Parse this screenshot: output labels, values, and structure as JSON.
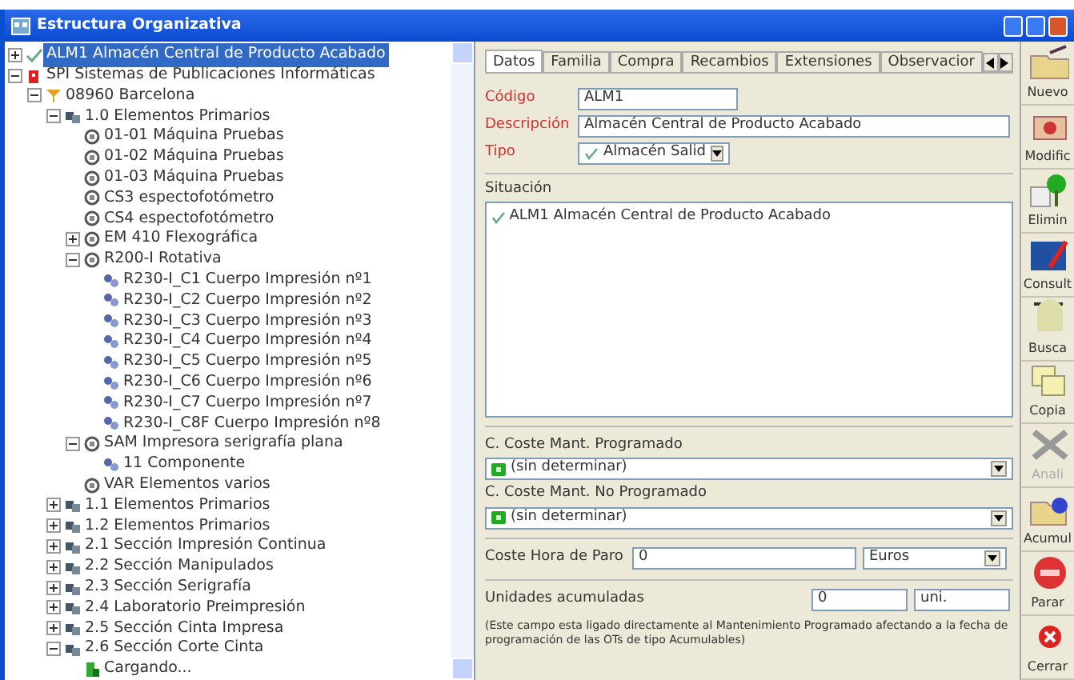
{
  "window": {
    "title": "Estructura Organizativa"
  },
  "tree": [
    {
      "label": "ALM1 Almacén Central de Producto Acabado",
      "kind": "check",
      "expanded": false,
      "selected": true
    },
    {
      "label": "SPI Sistemas de Publicaciones Informáticas",
      "kind": "company",
      "expanded": true,
      "selected": false,
      "children": [
        {
          "label": "08960 Barcelona",
          "kind": "site",
          "expanded": true,
          "selected": false,
          "children": [
            {
              "label": "1.0 Elementos Primarios",
              "kind": "group",
              "expanded": true,
              "selected": false,
              "children": [
                {
                  "label": "01-01 Máquina Pruebas",
                  "kind": "machine",
                  "selected": false
                },
                {
                  "label": "01-02 Máquina Pruebas",
                  "kind": "machine",
                  "selected": false
                },
                {
                  "label": "01-03 Máquina Pruebas",
                  "kind": "machine",
                  "selected": false
                },
                {
                  "label": "CS3 espectofotómetro",
                  "kind": "machine",
                  "selected": false
                },
                {
                  "label": "CS4 espectofotómetro",
                  "kind": "machine",
                  "selected": false
                },
                {
                  "label": "EM 410 Flexográfica",
                  "kind": "machine",
                  "expanded": false,
                  "selected": false
                },
                {
                  "label": "R200-I Rotativa",
                  "kind": "machine",
                  "expanded": true,
                  "selected": false,
                  "children": [
                    {
                      "label": "R230-I_C1 Cuerpo Impresión nº1",
                      "kind": "component",
                      "selected": false
                    },
                    {
                      "label": "R230-I_C2 Cuerpo Impresión nº2",
                      "kind": "component",
                      "selected": false
                    },
                    {
                      "label": "R230-I_C3 Cuerpo Impresión nº3",
                      "kind": "component",
                      "selected": false
                    },
                    {
                      "label": "R230-I_C4 Cuerpo Impresión nº4",
                      "kind": "component",
                      "selected": false
                    },
                    {
                      "label": "R230-I_C5 Cuerpo Impresión nº5",
                      "kind": "component",
                      "selected": false
                    },
                    {
                      "label": "R230-I_C6 Cuerpo Impresión nº6",
                      "kind": "component",
                      "selected": false
                    },
                    {
                      "label": "R230-I_C7 Cuerpo Impresión nº7",
                      "kind": "component",
                      "selected": false
                    },
                    {
                      "label": "R230-I_C8F Cuerpo Impresión nº8",
                      "kind": "component",
                      "selected": false
                    }
                  ]
                },
                {
                  "label": "SAM Impresora serigrafía plana",
                  "kind": "machine",
                  "expanded": true,
                  "selected": false,
                  "children": [
                    {
                      "label": "11 Componente",
                      "kind": "component",
                      "selected": false
                    }
                  ]
                },
                {
                  "label": "VAR Elementos varios",
                  "kind": "machine",
                  "selected": false
                }
              ]
            },
            {
              "label": "1.1 Elementos Primarios",
              "kind": "group",
              "expanded": false,
              "selected": false
            },
            {
              "label": "1.2 Elementos Primarios",
              "kind": "group",
              "expanded": false,
              "selected": false
            },
            {
              "label": "2.1 Sección Impresión Continua",
              "kind": "group",
              "expanded": false,
              "selected": false
            },
            {
              "label": "2.2 Sección Manipulados",
              "kind": "group",
              "expanded": false,
              "selected": false
            },
            {
              "label": "2.3 Sección Serigrafía",
              "kind": "group",
              "expanded": false,
              "selected": false
            },
            {
              "label": "2.4 Laboratorio Preimpresión",
              "kind": "group",
              "expanded": false,
              "selected": false
            },
            {
              "label": "2.5 Sección Cinta Impresa",
              "kind": "group",
              "expanded": false,
              "selected": false
            },
            {
              "label": "2.6 Sección Corte Cinta",
              "kind": "group",
              "expanded": true,
              "selected": false,
              "children": [
                {
                  "label": "Cargando...",
                  "kind": "loading",
                  "selected": false
                }
              ]
            }
          ]
        }
      ]
    }
  ],
  "tabs": [
    {
      "label": "Datos",
      "selected": true
    },
    {
      "label": "Familia",
      "selected": false
    },
    {
      "label": "Compra",
      "selected": false
    },
    {
      "label": "Recambios",
      "selected": false
    },
    {
      "label": "Extensiones",
      "selected": false
    },
    {
      "label": "Observacior",
      "selected": false
    }
  ],
  "form": {
    "codigo": {
      "label": "Código",
      "value": "ALM1"
    },
    "descripcion": {
      "label": "Descripción",
      "value": "Almacén Central de Producto Acabado"
    },
    "tipo": {
      "label": "Tipo",
      "value": "Almacén Salid"
    },
    "situacion": {
      "label": "Situación",
      "items": [
        "ALM1 Almacén Central de Producto Acabado"
      ]
    },
    "coste_programado": {
      "label": "C. Coste Mant. Programado",
      "value": "(sin determinar)"
    },
    "coste_no_programado": {
      "label": "C. Coste Mant. No Programado",
      "value": "(sin determinar)"
    },
    "coste_hora": {
      "label": "Coste Hora de Paro",
      "value": "0",
      "currency": "Euros"
    },
    "unidades": {
      "label": "Unidades acumuladas",
      "value": "0",
      "unit": "uni."
    },
    "note": "(Este campo esta ligado directamente al Mantenimiento Programado afectando a la fecha de programación de las OTs de tipo Acumulables)"
  },
  "toolbar": [
    {
      "label": "Nuevo",
      "kind": "new",
      "disabled": false
    },
    {
      "label": "Modific",
      "kind": "edit",
      "disabled": false
    },
    {
      "label": "Elimin",
      "kind": "delete",
      "disabled": false
    },
    {
      "label": "Consult",
      "kind": "query",
      "disabled": false
    },
    {
      "label": "Busca",
      "kind": "search",
      "disabled": false
    },
    {
      "label": "Copia",
      "kind": "copy",
      "disabled": false
    },
    {
      "label": "Anali",
      "kind": "analyze",
      "disabled": true
    },
    {
      "label": "Acumul",
      "kind": "accumulate",
      "disabled": false
    },
    {
      "label": "Parar",
      "kind": "stop",
      "disabled": false
    },
    {
      "label": "Cerrar",
      "kind": "close",
      "disabled": false
    }
  ]
}
